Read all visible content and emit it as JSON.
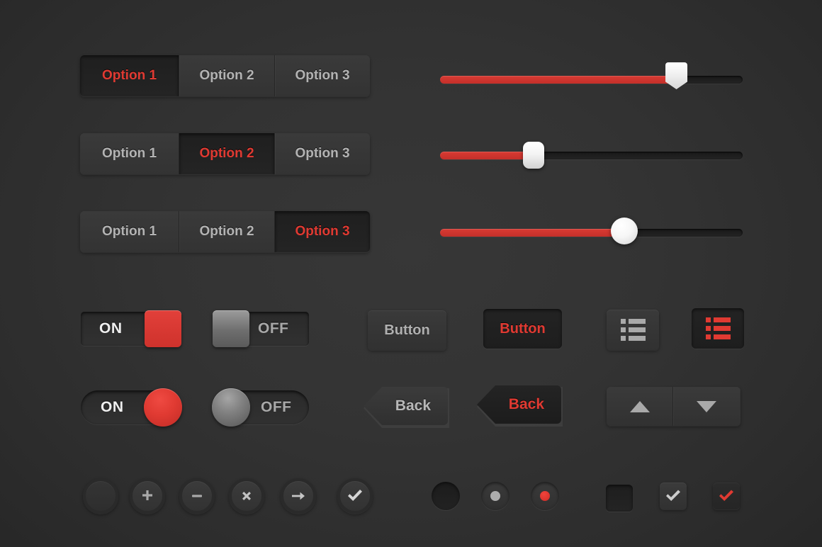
{
  "theme": {
    "background": "#2d2d2d",
    "accent_red": "#e03a32",
    "text_gray": "#b3b3b3",
    "text_light": "#efefef"
  },
  "segmented_controls": [
    {
      "name": "segmented-control-row-1",
      "active_index": 0,
      "options": [
        "Option 1",
        "Option 2",
        "Option 3"
      ]
    },
    {
      "name": "segmented-control-row-2",
      "active_index": 1,
      "options": [
        "Option 1",
        "Option 2",
        "Option 3"
      ]
    },
    {
      "name": "segmented-control-row-3",
      "active_index": 2,
      "options": [
        "Option 1",
        "Option 2",
        "Option 3"
      ]
    }
  ],
  "sliders": [
    {
      "name": "slider-pin-handle",
      "handle": "pin",
      "percent": 78
    },
    {
      "name": "slider-rect-handle",
      "handle": "rect",
      "percent": 31
    },
    {
      "name": "slider-circle-handle",
      "handle": "circle",
      "percent": 61
    }
  ],
  "toggles": [
    {
      "name": "toggle-square-on",
      "shape": "square",
      "state": "on",
      "label": "ON",
      "knob_color": "#d8342e"
    },
    {
      "name": "toggle-square-off",
      "shape": "square",
      "state": "off",
      "label": "OFF",
      "knob_color": "#7d7d7d"
    },
    {
      "name": "toggle-pill-on",
      "shape": "pill",
      "state": "on",
      "label": "ON",
      "knob_color": "#e03a32"
    },
    {
      "name": "toggle-pill-off",
      "shape": "pill",
      "state": "off",
      "label": "OFF",
      "knob_color": "#7d7d7d"
    }
  ],
  "buttons": [
    {
      "name": "button-default",
      "label": "Button",
      "state": "normal"
    },
    {
      "name": "button-active",
      "label": "Button",
      "state": "active"
    }
  ],
  "list_view_buttons": [
    {
      "name": "list-view-button-default",
      "state": "normal",
      "icon": "list-icon"
    },
    {
      "name": "list-view-button-active",
      "state": "active",
      "icon": "list-icon"
    }
  ],
  "back_buttons": [
    {
      "name": "back-button-default",
      "label": "Back",
      "state": "normal"
    },
    {
      "name": "back-button-active",
      "label": "Back",
      "state": "active"
    }
  ],
  "stepper": {
    "name": "stepper-control",
    "up_icon": "triangle-up-icon",
    "down_icon": "triangle-down-icon"
  },
  "circle_buttons": [
    {
      "name": "circle-button-blank",
      "icon": "blank-icon"
    },
    {
      "name": "circle-button-add",
      "icon": "plus-icon"
    },
    {
      "name": "circle-button-remove",
      "icon": "minus-icon"
    },
    {
      "name": "circle-button-close",
      "icon": "close-icon"
    },
    {
      "name": "circle-button-next",
      "icon": "arrow-right-icon"
    },
    {
      "name": "circle-button-confirm",
      "icon": "check-icon"
    }
  ],
  "radios": [
    {
      "name": "radio-unselected",
      "state": "empty"
    },
    {
      "name": "radio-selected-gray",
      "state": "gray"
    },
    {
      "name": "radio-selected-red",
      "state": "red"
    }
  ],
  "checkboxes": [
    {
      "name": "checkbox-unchecked",
      "state": "empty"
    },
    {
      "name": "checkbox-checked-gray",
      "state": "gray"
    },
    {
      "name": "checkbox-checked-red",
      "state": "red"
    }
  ]
}
